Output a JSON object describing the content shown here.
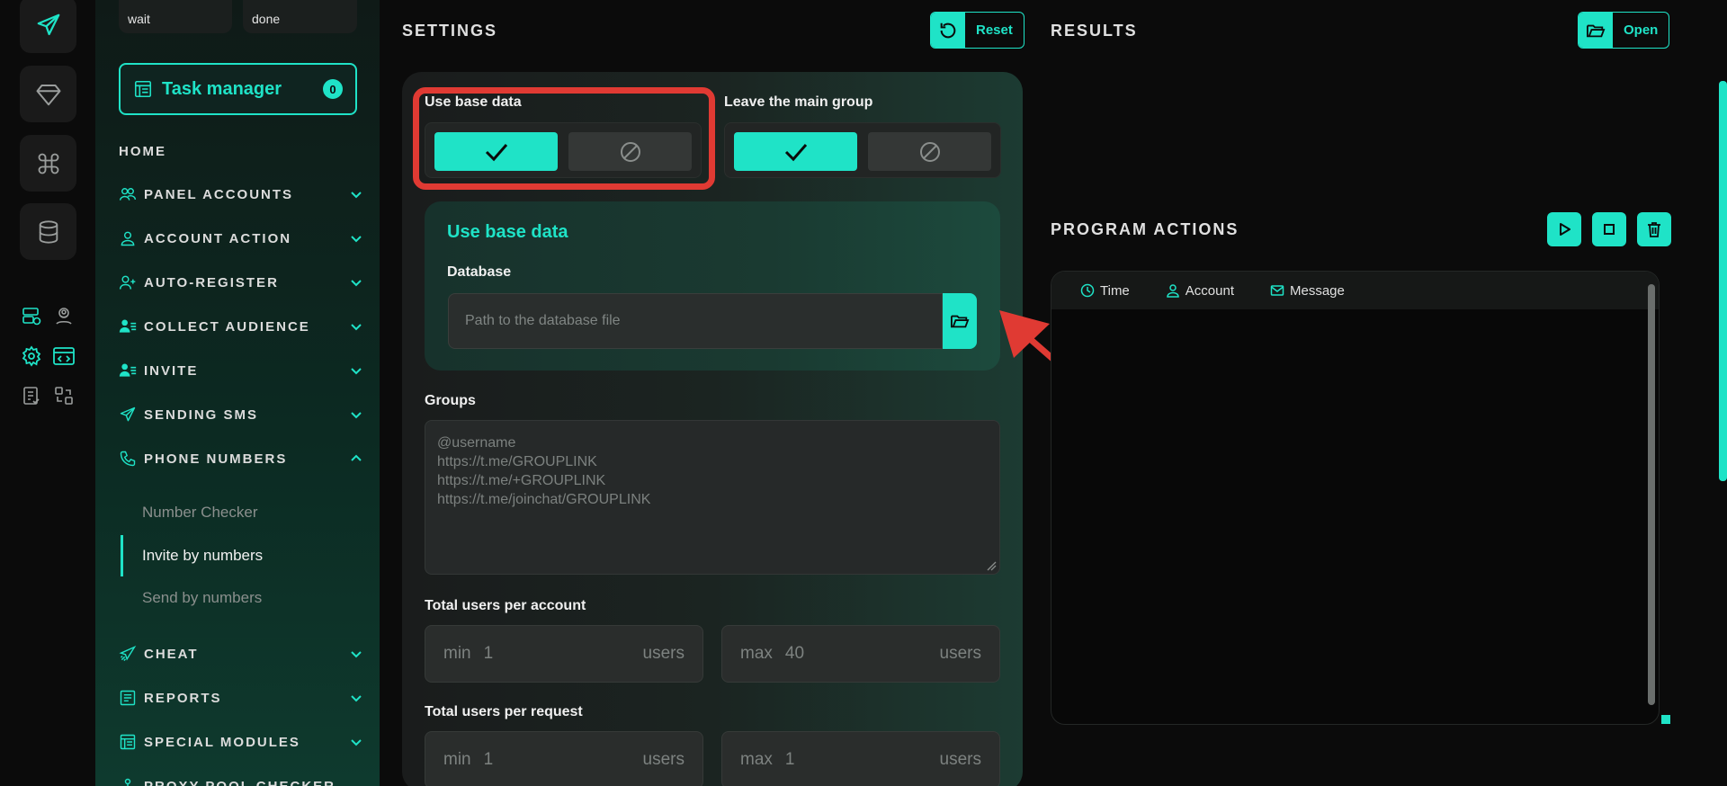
{
  "colors": {
    "accent": "#1fe3c7",
    "highlight": "#e03a33",
    "background": "#0b0b0b"
  },
  "status_cards": [
    "wait",
    "done"
  ],
  "task_manager": {
    "label": "Task manager",
    "count": "0"
  },
  "nav": [
    {
      "label": "HOME",
      "icon": "none"
    },
    {
      "label": "PANEL ACCOUNTS",
      "icon": "users-icon"
    },
    {
      "label": "ACCOUNT ACTION",
      "icon": "user-icon"
    },
    {
      "label": "AUTO-REGISTER",
      "icon": "user-plus-icon"
    },
    {
      "label": "COLLECT AUDIENCE",
      "icon": "user-list-icon"
    },
    {
      "label": "INVITE",
      "icon": "user-list-icon"
    },
    {
      "label": "SENDING SMS",
      "icon": "send-icon"
    },
    {
      "label": "PHONE NUMBERS",
      "icon": "phone-icon"
    },
    {
      "label": "CHEAT",
      "icon": "rocket-icon"
    },
    {
      "label": "REPORTS",
      "icon": "report-icon"
    },
    {
      "label": "SPECIAL MODULES",
      "icon": "modules-icon"
    },
    {
      "label": "PROXY POOL CHECKER",
      "icon": "proxy-icon"
    }
  ],
  "phone_numbers_sub": [
    "Number Checker",
    "Invite by numbers",
    "Send by numbers"
  ],
  "settings": {
    "title": "SETTINGS",
    "reset_label": "Reset",
    "use_base_data_label": "Use base data",
    "leave_main_group_label": "Leave the main group",
    "db_card_title": "Use base data",
    "database_label": "Database",
    "database_placeholder": "Path to the database file",
    "groups_label": "Groups",
    "groups_placeholder": "@username\nhttps://t.me/GROUPLINK\nhttps://t.me/+GROUPLINK\nhttps://t.me/joinchat/GROUPLINK",
    "total_users_account_label": "Total users per account",
    "total_users_account": {
      "min_prefix": "min",
      "min": "1",
      "max_prefix": "max",
      "max": "40",
      "unit": "users"
    },
    "total_users_request_label": "Total users per request",
    "total_users_request": {
      "min_prefix": "min",
      "min": "1",
      "max_prefix": "max",
      "max": "1",
      "unit": "users"
    }
  },
  "results": {
    "title": "RESULTS",
    "open_label": "Open",
    "program_actions_title": "PROGRAM ACTIONS",
    "columns": [
      "Time",
      "Account",
      "Message"
    ]
  }
}
